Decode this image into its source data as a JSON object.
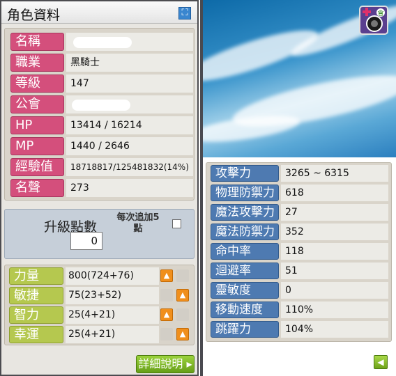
{
  "window": {
    "title": "角色資料",
    "close_icon": "resize-icon"
  },
  "info": [
    {
      "label": "名稱",
      "value": ""
    },
    {
      "label": "職業",
      "value": "黑騎士"
    },
    {
      "label": "等級",
      "value": "147"
    },
    {
      "label": "公會",
      "value": ""
    },
    {
      "label": "HP",
      "value": "13414 / 16214"
    },
    {
      "label": "MP",
      "value": "1440 / 2646"
    },
    {
      "label": "經驗值",
      "value": "18718817/125481832(14%)"
    },
    {
      "label": "名聲",
      "value": "273"
    }
  ],
  "ap": {
    "label": "升級點數",
    "value": "0",
    "per_line1": "每次追加5",
    "per_line2": "點",
    "auto_checked": false
  },
  "stats": [
    {
      "label": "力量",
      "value": "800(724+76)"
    },
    {
      "label": "敏捷",
      "value": "75(23+52)"
    },
    {
      "label": "智力",
      "value": "25(4+21)"
    },
    {
      "label": "幸運",
      "value": "25(4+21)"
    }
  ],
  "detail_button": "詳細說明",
  "detail_stats": [
    {
      "label": "攻擊力",
      "value": "3265 ~ 6315"
    },
    {
      "label": "物理防禦力",
      "value": "618"
    },
    {
      "label": "魔法攻擊力",
      "value": "27"
    },
    {
      "label": "魔法防禦力",
      "value": "352"
    },
    {
      "label": "命中率",
      "value": "118"
    },
    {
      "label": "迴避率",
      "value": "51"
    },
    {
      "label": "靈敏度",
      "value": "0"
    },
    {
      "label": "移動速度",
      "value": "110%"
    },
    {
      "label": "跳躍力",
      "value": "104%"
    }
  ],
  "colors": {
    "info_label": "#d44f7c",
    "stat_label": "#b5c84f",
    "detail_label": "#4e7ab1",
    "up_button": "#f08f1c"
  },
  "icons": {
    "up": "arrow-up-icon",
    "back": "arrow-left-icon",
    "character": "character-icon"
  }
}
